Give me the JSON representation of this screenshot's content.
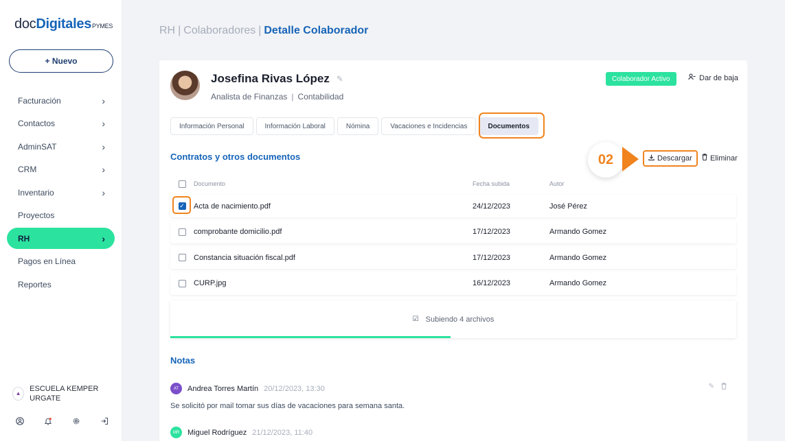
{
  "logo": {
    "doc": "doc",
    "digitales": "Digitales",
    "pymes": "PYMES"
  },
  "sidebar": {
    "new_label": "+ Nuevo",
    "items": [
      {
        "label": "Facturación",
        "chevron": true
      },
      {
        "label": "Contactos",
        "chevron": true
      },
      {
        "label": "AdminSAT",
        "chevron": true
      },
      {
        "label": "CRM",
        "chevron": true
      },
      {
        "label": "Inventario",
        "chevron": true
      },
      {
        "label": "Proyectos",
        "chevron": false
      },
      {
        "label": "RH",
        "chevron": true,
        "active": true
      },
      {
        "label": "Pagos en Línea",
        "chevron": false
      },
      {
        "label": "Reportes",
        "chevron": false
      }
    ],
    "org_name": "ESCUELA KEMPER URGATE",
    "footer_icons": [
      "user-icon",
      "bell-icon",
      "gear-icon",
      "logout-icon"
    ]
  },
  "breadcrumb": {
    "part1": "RH",
    "part2": "Colaboradores",
    "current": "Detalle Colaborador",
    "sep": "|"
  },
  "employee": {
    "name": "Josefina Rivas López",
    "role": "Analista de Finanzas",
    "department": "Contabilidad",
    "status": "Colaborador Activo",
    "deactivate_label": "Dar de baja"
  },
  "tabs": [
    "Información Personal",
    "Información Laboral",
    "Nómina",
    "Vacaciones e Incidencias",
    "Documentos"
  ],
  "active_tab": "Documentos",
  "documents": {
    "title": "Contratos y otros documentos",
    "step_label": "02",
    "download_label": "Descargar",
    "delete_label": "Eliminar",
    "columns": {
      "doc": "Documento",
      "date": "Fecha subida",
      "author": "Autor"
    },
    "rows": [
      {
        "name": "Acta de nacimiento.pdf",
        "date": "24/12/2023",
        "author": "José Pérez",
        "checked": true
      },
      {
        "name": "comprobante domicilio.pdf",
        "date": "17/12/2023",
        "author": "Armando Gomez",
        "checked": false
      },
      {
        "name": "Constancia situación fiscal.pdf",
        "date": "17/12/2023",
        "author": "Armando Gomez",
        "checked": false
      },
      {
        "name": "CURP.jpg",
        "date": "16/12/2023",
        "author": "Armando Gomez",
        "checked": false
      }
    ],
    "upload_text": "Subiendo 4 archivos",
    "upload_progress": 0.495
  },
  "notes": {
    "title": "Notas",
    "items": [
      {
        "initials": "AT",
        "author": "Andrea Torres Martín",
        "time": "20/12/2023, 13:30",
        "text": "Se solicitó por mail tomar sus días de vacaciones para semana santa.",
        "color": "#7b4fc9"
      },
      {
        "initials": "MR",
        "author": "Miguel Rodríguez",
        "time": "21/12/2023, 11:40",
        "text": "",
        "color": "#2ce29f"
      }
    ]
  },
  "colors": {
    "accent": "#1664b8",
    "green": "#2ce29f",
    "orange": "#f0831e"
  }
}
